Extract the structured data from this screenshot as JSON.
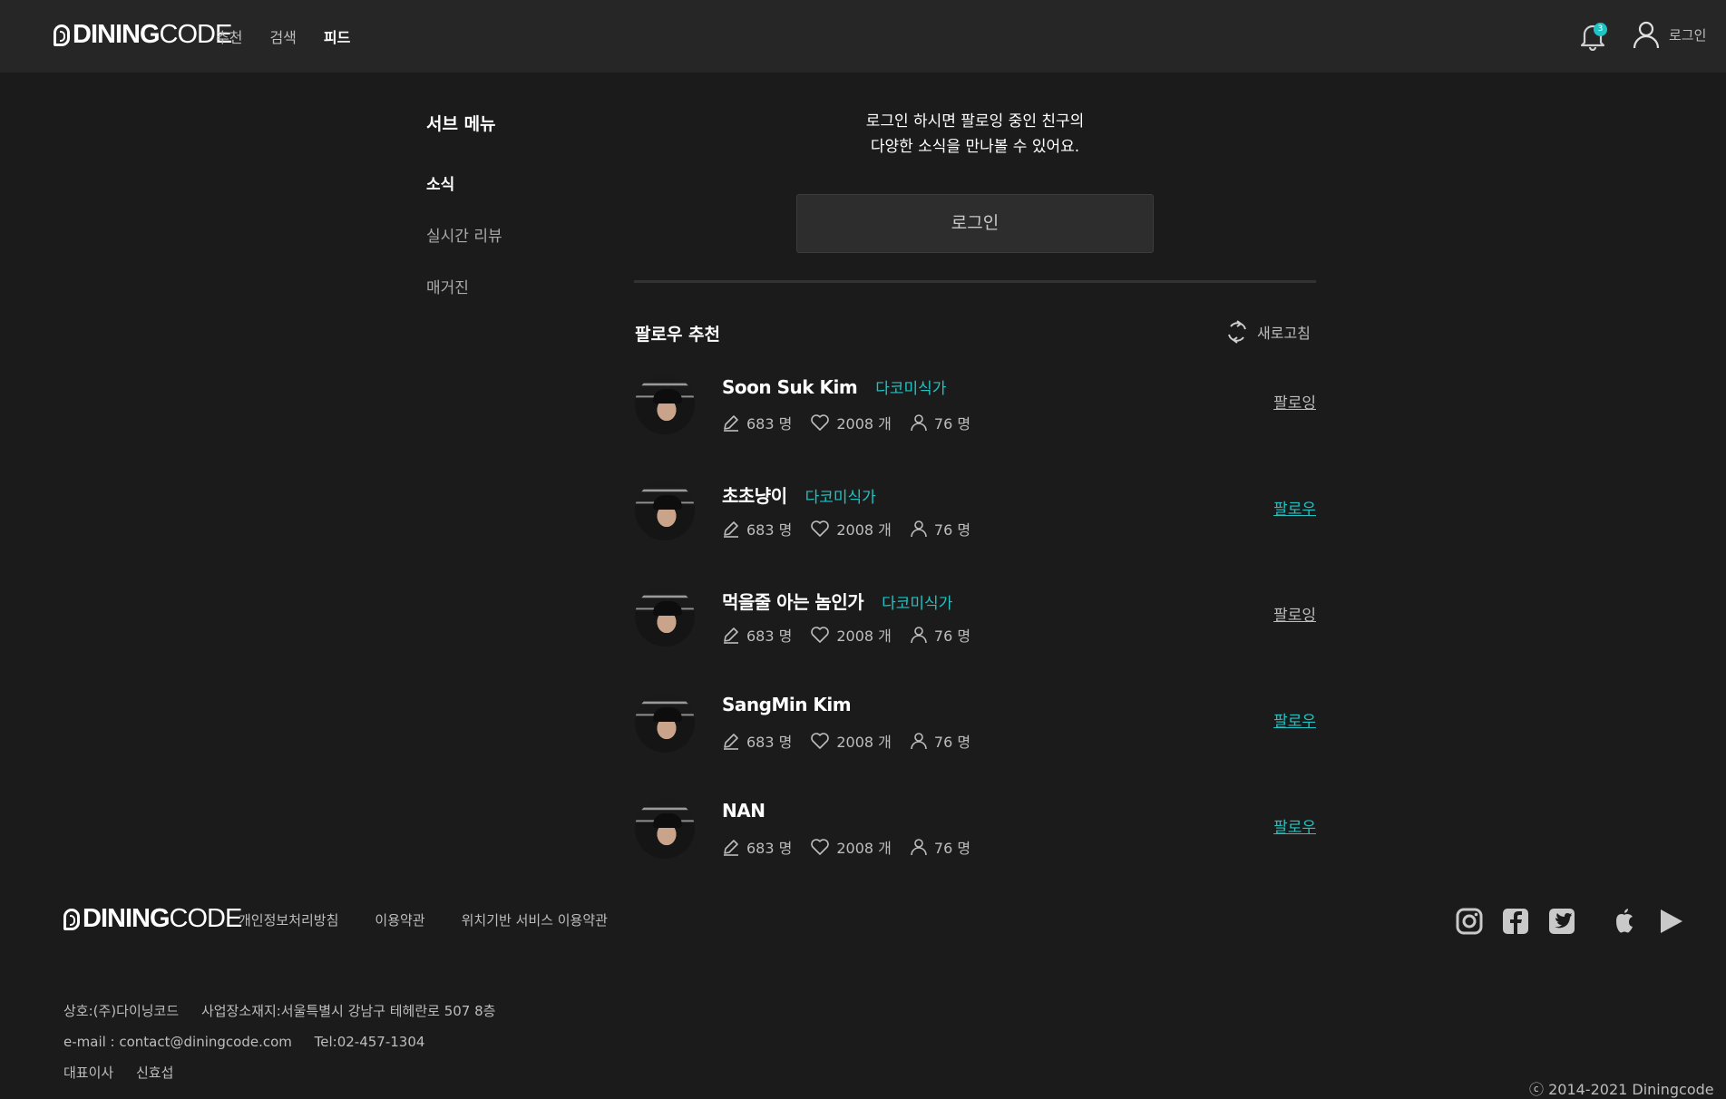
{
  "header": {
    "brand_bold": "DINING",
    "brand_light": "CODE",
    "nav": [
      {
        "label": "추천"
      },
      {
        "label": "검색"
      },
      {
        "label": "피드"
      }
    ],
    "notification_count": "3",
    "login_label": "로그인"
  },
  "submenu": {
    "title": "서브 메뉴",
    "items": [
      {
        "label": "소식"
      },
      {
        "label": "실시간 리뷰"
      },
      {
        "label": "매거진"
      }
    ]
  },
  "main": {
    "login_message_line1": "로그인 하시면 팔로잉 중인 친구의",
    "login_message_line2": "다양한 소식을 만나볼 수 있어요.",
    "login_button": "로그인",
    "recommend_title": "팔로우 추천",
    "refresh_label": "새로고침",
    "users": [
      {
        "name": "Soon Suk Kim",
        "badge": "다코미식가",
        "reviews": "683 명",
        "likes": "2008 개",
        "followers": "76 명",
        "action": "팔로잉"
      },
      {
        "name": "초초냥이",
        "badge": "다코미식가",
        "reviews": "683 명",
        "likes": "2008 개",
        "followers": "76 명",
        "action": "팔로우"
      },
      {
        "name": "먹을줄 아는 놈인가",
        "badge": "다코미식가",
        "reviews": "683 명",
        "likes": "2008 개",
        "followers": "76 명",
        "action": "팔로잉"
      },
      {
        "name": "SangMin Kim",
        "badge": "",
        "reviews": "683 명",
        "likes": "2008 개",
        "followers": "76 명",
        "action": "팔로우"
      },
      {
        "name": "NAN",
        "badge": "",
        "reviews": "683 명",
        "likes": "2008 개",
        "followers": "76 명",
        "action": "팔로우"
      }
    ]
  },
  "footer": {
    "links": [
      {
        "label": "개인정보처리방침"
      },
      {
        "label": "이용약관"
      },
      {
        "label": "위치기반 서비스 이용약관"
      }
    ],
    "company": "상호:(주)다이닝코드",
    "address": "사업장소재지:서울특별시 강남구 테헤란로 507 8층",
    "email": "e-mail : contact@diningcode.com",
    "tel": "Tel:02-457-1304",
    "ceo_label": "대표이사",
    "ceo_name": "신효섭",
    "copyright": "ⓒ 2014-2021 Diningcode"
  },
  "colors": {
    "background": "#1b1b1b",
    "header": "#262626",
    "accent": "#1fc3c3"
  }
}
